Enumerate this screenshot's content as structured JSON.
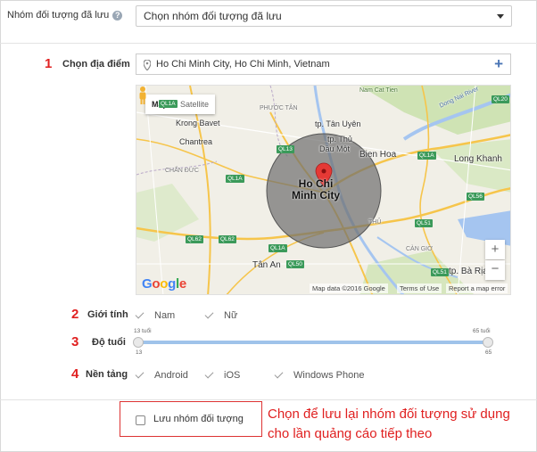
{
  "saved_audience": {
    "label": "Nhóm đối tượng đã lưu",
    "info_icon": "?",
    "select_value": "Chọn nhóm đối tượng đã lưu"
  },
  "location": {
    "step": "1",
    "label": "Chọn địa điểm",
    "value": "Ho Chi Minh City, Ho Chi Minh, Vietnam",
    "add_icon": "+"
  },
  "map": {
    "tab_map": "Map",
    "tab_satellite": "Satellite",
    "city_line1": "Ho Chi",
    "city_line2": "Minh City",
    "labels": [
      "tp. Tân Uyên",
      "tp. Thủ",
      "Dầu Một",
      "Bien Hoa",
      "Long Khanh",
      "Tân An",
      "tp. Bà Rịa",
      "Chantrea",
      "Krong Bavet",
      "Nam Cat Tien",
      "Dong Nai River",
      "PHƯỚC TÂN",
      "THỦ",
      "CÀN GIỜ",
      "CHẤN ĐỨC"
    ],
    "shields": [
      "QL20",
      "QL1A",
      "QL13",
      "QL1A",
      "QL51",
      "QL62",
      "QL62",
      "QL1A",
      "QL50",
      "QL1A",
      "QL51",
      "QL56"
    ],
    "zoom_in": "+",
    "zoom_out": "−",
    "logo": "Google",
    "attrib_data": "Map data ©2016 Google",
    "attrib_terms": "Terms of Use",
    "attrib_report": "Report a map error"
  },
  "gender": {
    "step": "2",
    "label": "Giới tính",
    "options": [
      "Nam",
      "Nữ"
    ]
  },
  "age": {
    "step": "3",
    "label": "Độ tuổi",
    "min_top": "13 tuổi",
    "max_top": "65 tuổi",
    "min": "13",
    "max": "65",
    "selected_min": 13,
    "selected_max": 65
  },
  "platform": {
    "step": "4",
    "label": "Nền tảng",
    "options": [
      "Android",
      "iOS",
      "Windows Phone"
    ]
  },
  "save": {
    "label": "Lưu nhóm đối tượng"
  },
  "annotation": {
    "line1": "Chọn để lưu lại nhóm đối tượng sử dụng",
    "line2": "cho lần quảng cáo tiếp theo"
  },
  "colors": {
    "accent": "#4a75b5",
    "annotation_red": "#e02020",
    "marker_red": "#e53935",
    "radius_gray": "#6e6e6e",
    "slider_blue": "#9fc3ea"
  }
}
